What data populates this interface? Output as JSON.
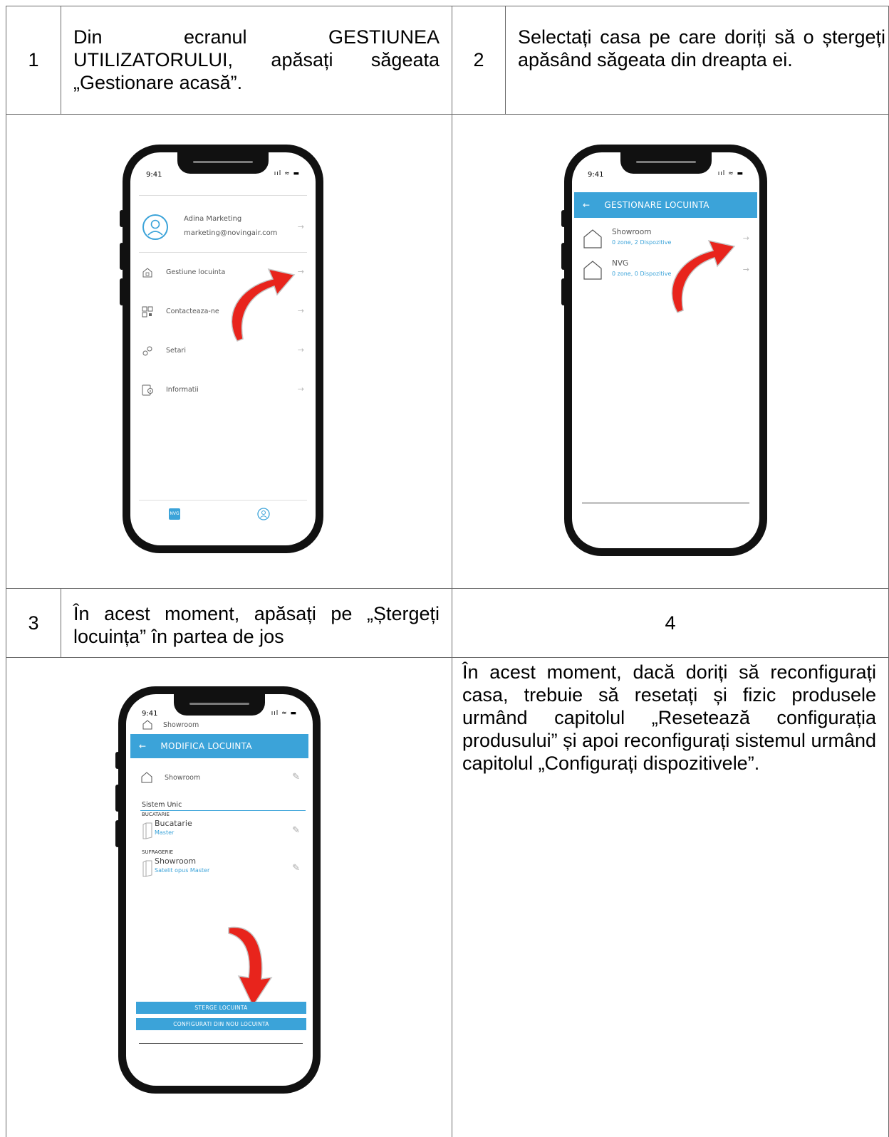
{
  "steps": [
    {
      "number": "1",
      "text": "Din ecranul GESTIUNEA UTILIZATORULUI, apăsați săgeata „Gestionare acasă”."
    },
    {
      "number": "2",
      "text": "Selectați casa pe care doriți să o ștergeți apăsând săgeata din dreapta ei."
    },
    {
      "number": "3",
      "text": "În acest moment, apăsați pe „Ștergeți locuința” în partea de jos"
    },
    {
      "number": "4",
      "text": "În acest moment, dacă doriți să reconfigurați casa, trebuie să resetați și fizic produsele urmând capitolul „Resetează configurația produsului” și apoi reconfigurați sistemul urmând capitolul „Configurați dispozitivele”."
    }
  ],
  "phone1": {
    "time": "9:41",
    "status": "ııl ≈ ▬",
    "profile": {
      "name": "Adina Marketing",
      "email": "marketing@novingair.com",
      "icon": "user-circle-icon"
    },
    "menu": [
      {
        "label": "Gestiune locuinta",
        "icon": "house-icon"
      },
      {
        "label": "Contacteaza-ne",
        "icon": "qr-icon"
      },
      {
        "label": "Setari",
        "icon": "gears-icon"
      },
      {
        "label": "Informatii",
        "icon": "info-icon"
      }
    ],
    "nav": {
      "left": "NVG",
      "right": "user-icon"
    }
  },
  "phone2": {
    "time": "9:41",
    "status": "ııl ≈ ▬",
    "header": "GESTIONARE LOCUINTA",
    "homes": [
      {
        "name": "Showroom",
        "sub": "0 zone, 2 Dispozitive"
      },
      {
        "name": "NVG",
        "sub": "0 zone, 0 Dispozitive"
      }
    ]
  },
  "phone3": {
    "time": "9:41",
    "status": "ııl ≈ ▬",
    "top_label": "Showroom",
    "header": "MODIFICA LOCUINTA",
    "home_name": "Showroom",
    "system": "Sistem Unic",
    "rooms": [
      {
        "room": "BUCATARIE",
        "device": "Bucatarie",
        "role": "Master"
      },
      {
        "room": "SUFRAGERIE",
        "device": "Showroom",
        "role": "Satelit opus Master"
      }
    ],
    "delete_button": "STERGE LOCUINTA",
    "reconfig_button": "CONFIGURATI DIN NOU LOCUINTA"
  },
  "colors": {
    "accent": "#3ba3d9",
    "arrow": "#e8241c",
    "border": "#6b6b6b"
  }
}
